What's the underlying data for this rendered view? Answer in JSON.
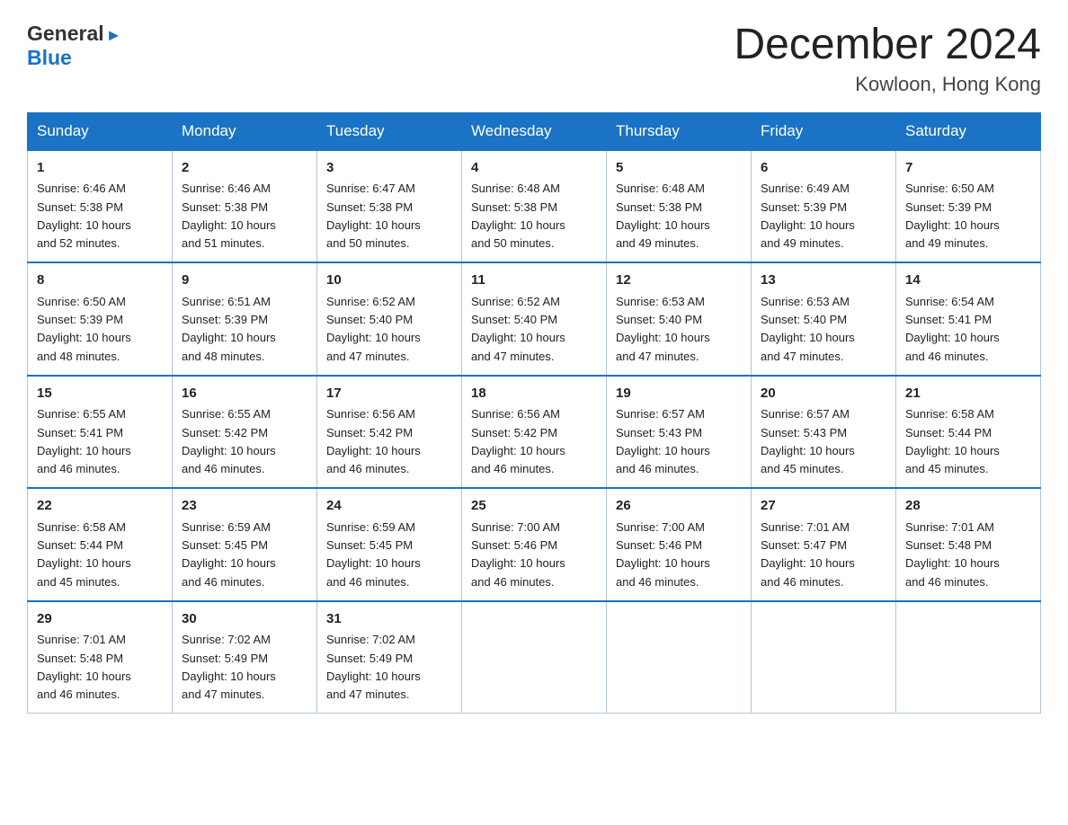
{
  "logo": {
    "general": "General",
    "blue": "Blue",
    "arrow": "▶"
  },
  "title": "December 2024",
  "subtitle": "Kowloon, Hong Kong",
  "days": [
    "Sunday",
    "Monday",
    "Tuesday",
    "Wednesday",
    "Thursday",
    "Friday",
    "Saturday"
  ],
  "weeks": [
    [
      {
        "num": "1",
        "sunrise": "6:46 AM",
        "sunset": "5:38 PM",
        "daylight": "10 hours and 52 minutes."
      },
      {
        "num": "2",
        "sunrise": "6:46 AM",
        "sunset": "5:38 PM",
        "daylight": "10 hours and 51 minutes."
      },
      {
        "num": "3",
        "sunrise": "6:47 AM",
        "sunset": "5:38 PM",
        "daylight": "10 hours and 50 minutes."
      },
      {
        "num": "4",
        "sunrise": "6:48 AM",
        "sunset": "5:38 PM",
        "daylight": "10 hours and 50 minutes."
      },
      {
        "num": "5",
        "sunrise": "6:48 AM",
        "sunset": "5:38 PM",
        "daylight": "10 hours and 49 minutes."
      },
      {
        "num": "6",
        "sunrise": "6:49 AM",
        "sunset": "5:39 PM",
        "daylight": "10 hours and 49 minutes."
      },
      {
        "num": "7",
        "sunrise": "6:50 AM",
        "sunset": "5:39 PM",
        "daylight": "10 hours and 49 minutes."
      }
    ],
    [
      {
        "num": "8",
        "sunrise": "6:50 AM",
        "sunset": "5:39 PM",
        "daylight": "10 hours and 48 minutes."
      },
      {
        "num": "9",
        "sunrise": "6:51 AM",
        "sunset": "5:39 PM",
        "daylight": "10 hours and 48 minutes."
      },
      {
        "num": "10",
        "sunrise": "6:52 AM",
        "sunset": "5:40 PM",
        "daylight": "10 hours and 47 minutes."
      },
      {
        "num": "11",
        "sunrise": "6:52 AM",
        "sunset": "5:40 PM",
        "daylight": "10 hours and 47 minutes."
      },
      {
        "num": "12",
        "sunrise": "6:53 AM",
        "sunset": "5:40 PM",
        "daylight": "10 hours and 47 minutes."
      },
      {
        "num": "13",
        "sunrise": "6:53 AM",
        "sunset": "5:40 PM",
        "daylight": "10 hours and 47 minutes."
      },
      {
        "num": "14",
        "sunrise": "6:54 AM",
        "sunset": "5:41 PM",
        "daylight": "10 hours and 46 minutes."
      }
    ],
    [
      {
        "num": "15",
        "sunrise": "6:55 AM",
        "sunset": "5:41 PM",
        "daylight": "10 hours and 46 minutes."
      },
      {
        "num": "16",
        "sunrise": "6:55 AM",
        "sunset": "5:42 PM",
        "daylight": "10 hours and 46 minutes."
      },
      {
        "num": "17",
        "sunrise": "6:56 AM",
        "sunset": "5:42 PM",
        "daylight": "10 hours and 46 minutes."
      },
      {
        "num": "18",
        "sunrise": "6:56 AM",
        "sunset": "5:42 PM",
        "daylight": "10 hours and 46 minutes."
      },
      {
        "num": "19",
        "sunrise": "6:57 AM",
        "sunset": "5:43 PM",
        "daylight": "10 hours and 46 minutes."
      },
      {
        "num": "20",
        "sunrise": "6:57 AM",
        "sunset": "5:43 PM",
        "daylight": "10 hours and 45 minutes."
      },
      {
        "num": "21",
        "sunrise": "6:58 AM",
        "sunset": "5:44 PM",
        "daylight": "10 hours and 45 minutes."
      }
    ],
    [
      {
        "num": "22",
        "sunrise": "6:58 AM",
        "sunset": "5:44 PM",
        "daylight": "10 hours and 45 minutes."
      },
      {
        "num": "23",
        "sunrise": "6:59 AM",
        "sunset": "5:45 PM",
        "daylight": "10 hours and 46 minutes."
      },
      {
        "num": "24",
        "sunrise": "6:59 AM",
        "sunset": "5:45 PM",
        "daylight": "10 hours and 46 minutes."
      },
      {
        "num": "25",
        "sunrise": "7:00 AM",
        "sunset": "5:46 PM",
        "daylight": "10 hours and 46 minutes."
      },
      {
        "num": "26",
        "sunrise": "7:00 AM",
        "sunset": "5:46 PM",
        "daylight": "10 hours and 46 minutes."
      },
      {
        "num": "27",
        "sunrise": "7:01 AM",
        "sunset": "5:47 PM",
        "daylight": "10 hours and 46 minutes."
      },
      {
        "num": "28",
        "sunrise": "7:01 AM",
        "sunset": "5:48 PM",
        "daylight": "10 hours and 46 minutes."
      }
    ],
    [
      {
        "num": "29",
        "sunrise": "7:01 AM",
        "sunset": "5:48 PM",
        "daylight": "10 hours and 46 minutes."
      },
      {
        "num": "30",
        "sunrise": "7:02 AM",
        "sunset": "5:49 PM",
        "daylight": "10 hours and 47 minutes."
      },
      {
        "num": "31",
        "sunrise": "7:02 AM",
        "sunset": "5:49 PM",
        "daylight": "10 hours and 47 minutes."
      },
      null,
      null,
      null,
      null
    ]
  ],
  "labels": {
    "sunrise": "Sunrise:",
    "sunset": "Sunset:",
    "daylight": "Daylight:"
  }
}
